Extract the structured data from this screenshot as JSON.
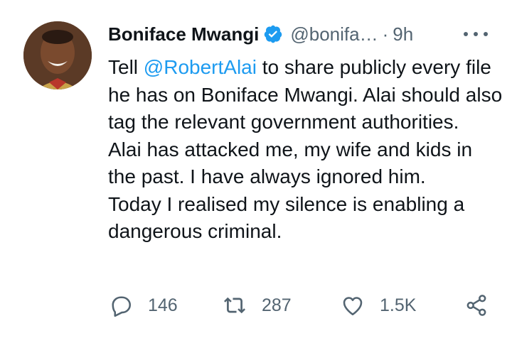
{
  "author": {
    "name": "Boniface Mwangi",
    "handle": "@bonifa…",
    "separator": "·",
    "time": "9h",
    "verified_color": "#1d9bf0"
  },
  "tweet": {
    "mention": "@RobertAlai",
    "line1_pre": "Tell ",
    "line1_post": " to share publicly every file he has on Boniface Mwangi. Alai should also tag the relevant government authorities.",
    "paragraph2": "Alai has attacked me, my wife and kids in the past. I have always ignored him.",
    "paragraph3": "Today I realised my silence is enabling a dangerous criminal."
  },
  "actions": {
    "replies": "146",
    "retweets": "287",
    "likes": "1.5K",
    "icons": [
      "reply-icon",
      "retweet-icon",
      "like-icon",
      "share-icon"
    ]
  },
  "colors": {
    "text": "#0f1419",
    "secondary": "#536471",
    "link": "#1d9bf0"
  }
}
